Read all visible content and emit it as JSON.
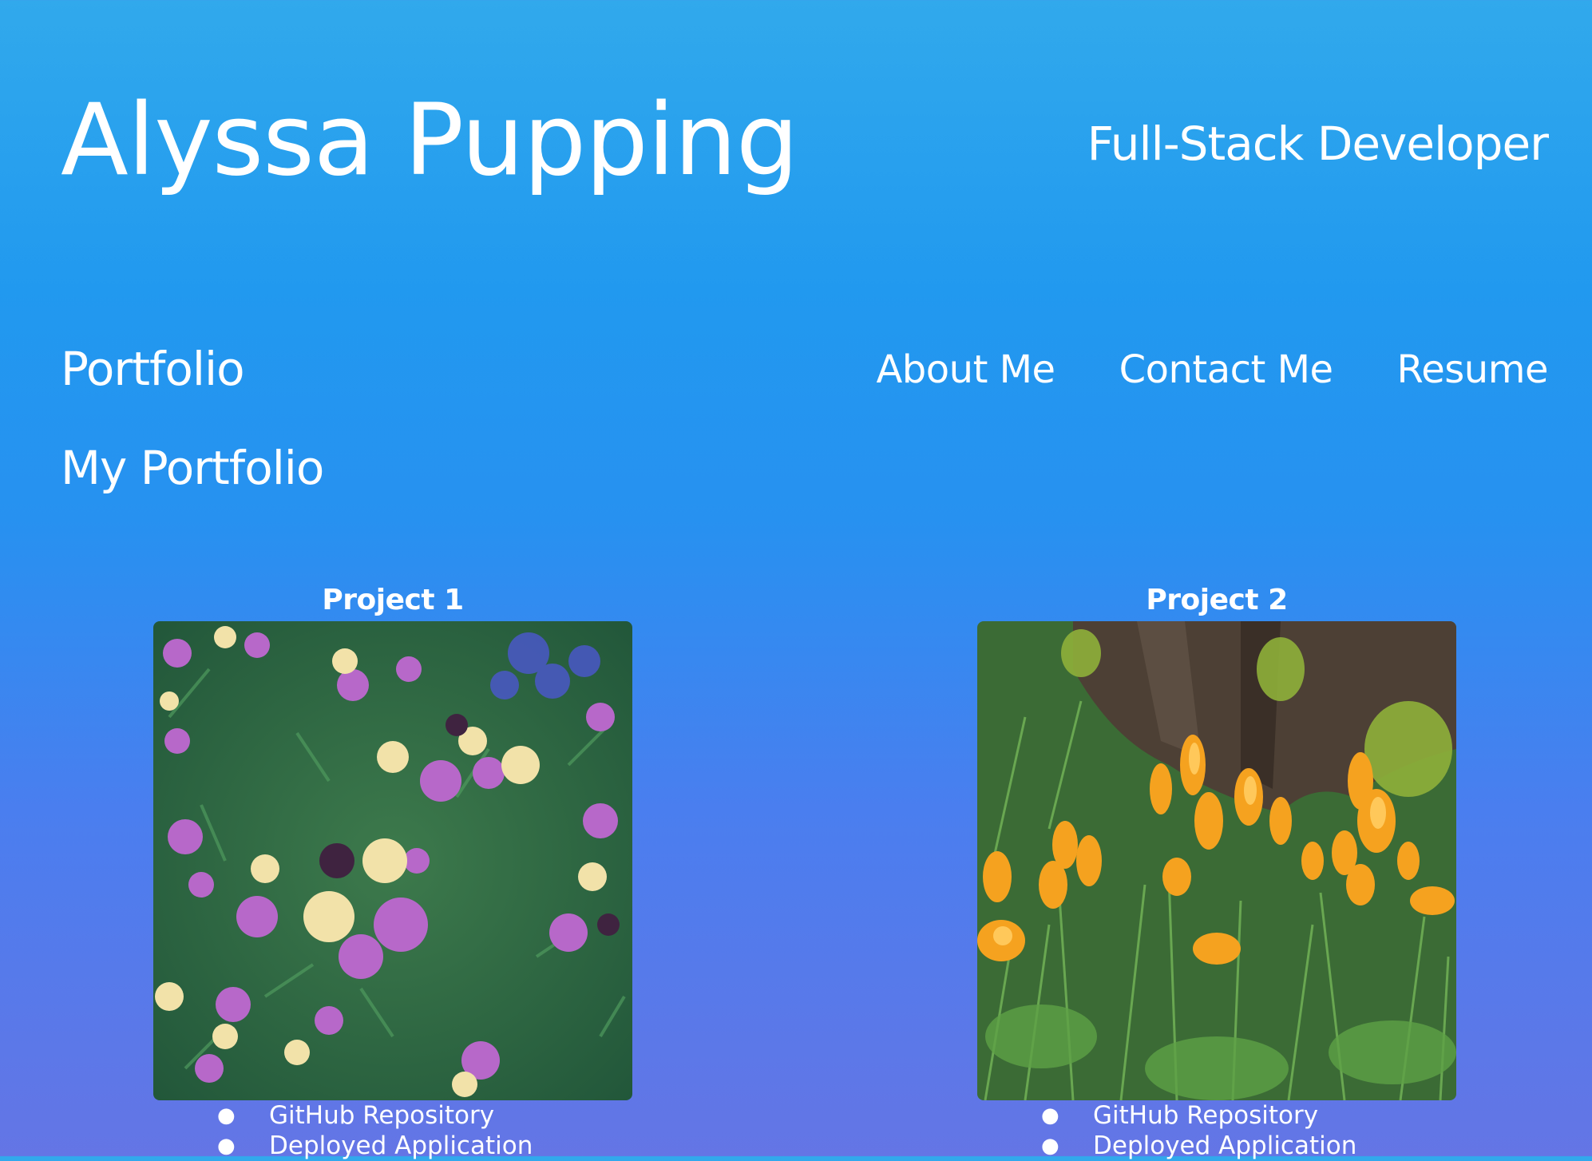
{
  "header": {
    "name": "Alyssa Pupping",
    "tagline": "Full-Stack Developer"
  },
  "nav": {
    "section_title": "Portfolio",
    "links": [
      {
        "label": "About Me"
      },
      {
        "label": "Contact Me"
      },
      {
        "label": "Resume"
      }
    ]
  },
  "main": {
    "heading": "My Portfolio",
    "projects": [
      {
        "title": "Project 1",
        "image": "purple-and-cream-flowers-photo",
        "links": [
          "GitHub Repository",
          "Deployed Application"
        ]
      },
      {
        "title": "Project 2",
        "image": "orange-crocus-flowers-photo",
        "links": [
          "GitHub Repository",
          "Deployed Application"
        ]
      }
    ]
  },
  "colors": {
    "gradient_top": "#31a9ec",
    "gradient_bottom": "#6475e5",
    "text": "#ffffff"
  }
}
